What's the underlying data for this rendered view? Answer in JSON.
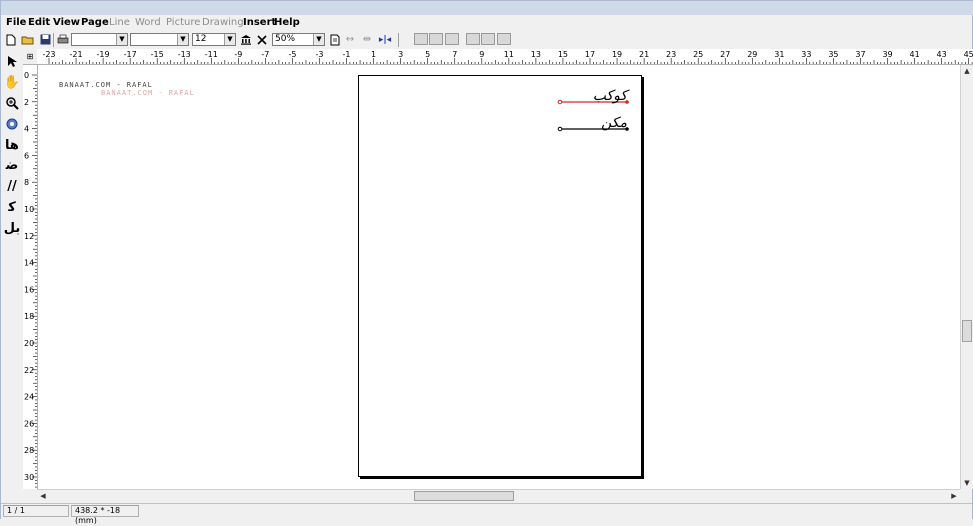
{
  "menu": {
    "items": [
      {
        "label": "File",
        "enabled": true
      },
      {
        "label": "Edit",
        "enabled": true
      },
      {
        "label": "View",
        "enabled": true
      },
      {
        "label": "Page",
        "enabled": true
      },
      {
        "label": "Line",
        "enabled": false
      },
      {
        "label": "Word",
        "enabled": false
      },
      {
        "label": "Picture",
        "enabled": false
      },
      {
        "label": "Drawing",
        "enabled": false
      },
      {
        "label": "Insert",
        "enabled": true
      },
      {
        "label": "Help",
        "enabled": true
      }
    ]
  },
  "toolbar": {
    "font_size": "12",
    "zoom": "50%"
  },
  "ruler": {
    "horizontal_labels": [
      "-23",
      "-21",
      "-19",
      "-17",
      "-15",
      "-13",
      "-11",
      "-9",
      "-7",
      "-5",
      "-3",
      "-1",
      "1",
      "3",
      "5",
      "7",
      "9",
      "11",
      "13",
      "15",
      "17",
      "19",
      "21",
      "23",
      "25",
      "27",
      "29",
      "31",
      "33",
      "35",
      "37",
      "39",
      "41",
      "43",
      "45"
    ],
    "vertical_labels": [
      "0",
      "2",
      "4",
      "6",
      "8",
      "10",
      "12",
      "14",
      "16",
      "18",
      "20",
      "22",
      "24",
      "26",
      "28",
      "30"
    ]
  },
  "watermark": {
    "line1": "BANAAT.COM - RAFAL",
    "line2": "BANAAT.COM - RAFAL"
  },
  "document": {
    "line1_text": "کوکب",
    "line2_text": "مکن",
    "line1_color": "#e02020",
    "line2_color": "#000000"
  },
  "status": {
    "page": "1 / 1",
    "position": "438.2 * -18 (mm)"
  }
}
